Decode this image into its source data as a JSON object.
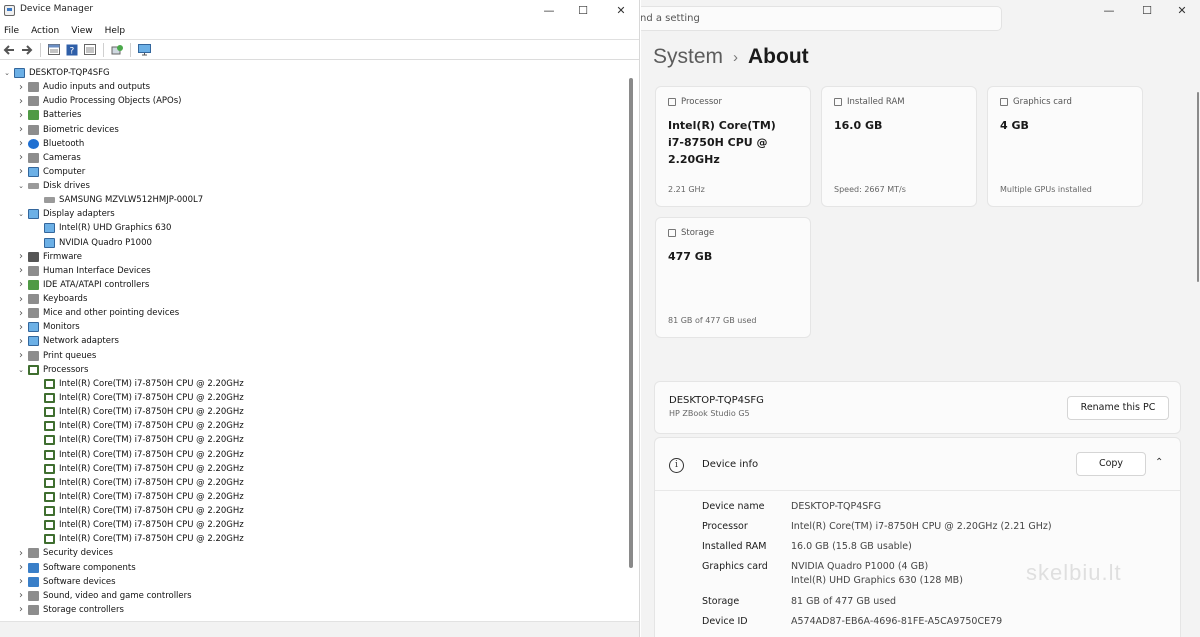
{
  "device_manager": {
    "title": "Device Manager",
    "menu": [
      "File",
      "Action",
      "View",
      "Help"
    ],
    "toolbar_icons": [
      "back-icon",
      "forward-icon",
      "properties-icon",
      "help-icon",
      "view-icon",
      "scan-icon",
      "monitor-icon"
    ],
    "tree": [
      {
        "label": "DESKTOP-TQP4SFG",
        "level": 0,
        "expanded": true,
        "icon": "computer"
      },
      {
        "label": "Audio inputs and outputs",
        "level": 1,
        "expanded": false,
        "icon": "gray"
      },
      {
        "label": "Audio Processing Objects (APOs)",
        "level": 1,
        "expanded": false,
        "icon": "gray"
      },
      {
        "label": "Batteries",
        "level": 1,
        "expanded": false,
        "icon": "green"
      },
      {
        "label": "Biometric devices",
        "level": 1,
        "expanded": false,
        "icon": "gray"
      },
      {
        "label": "Bluetooth",
        "level": 1,
        "expanded": false,
        "icon": "bt"
      },
      {
        "label": "Cameras",
        "level": 1,
        "expanded": false,
        "icon": "gray"
      },
      {
        "label": "Computer",
        "level": 1,
        "expanded": false,
        "icon": "mon"
      },
      {
        "label": "Disk drives",
        "level": 1,
        "expanded": true,
        "icon": "disk"
      },
      {
        "label": "SAMSUNG MZVLW512HMJP-000L7",
        "level": 2,
        "icon": "disk"
      },
      {
        "label": "Display adapters",
        "level": 1,
        "expanded": true,
        "icon": "mon"
      },
      {
        "label": "Intel(R) UHD Graphics 630",
        "level": 2,
        "icon": "mon"
      },
      {
        "label": "NVIDIA Quadro P1000",
        "level": 2,
        "icon": "mon"
      },
      {
        "label": "Firmware",
        "level": 1,
        "expanded": false,
        "icon": "dark"
      },
      {
        "label": "Human Interface Devices",
        "level": 1,
        "expanded": false,
        "icon": "gray"
      },
      {
        "label": "IDE ATA/ATAPI controllers",
        "level": 1,
        "expanded": false,
        "icon": "green"
      },
      {
        "label": "Keyboards",
        "level": 1,
        "expanded": false,
        "icon": "gray"
      },
      {
        "label": "Mice and other pointing devices",
        "level": 1,
        "expanded": false,
        "icon": "gray"
      },
      {
        "label": "Monitors",
        "level": 1,
        "expanded": false,
        "icon": "mon"
      },
      {
        "label": "Network adapters",
        "level": 1,
        "expanded": false,
        "icon": "mon"
      },
      {
        "label": "Print queues",
        "level": 1,
        "expanded": false,
        "icon": "gray"
      },
      {
        "label": "Processors",
        "level": 1,
        "expanded": true,
        "icon": "cpu"
      },
      {
        "label": "Intel(R) Core(TM) i7-8750H CPU @ 2.20GHz",
        "level": 2,
        "icon": "cpu"
      },
      {
        "label": "Intel(R) Core(TM) i7-8750H CPU @ 2.20GHz",
        "level": 2,
        "icon": "cpu"
      },
      {
        "label": "Intel(R) Core(TM) i7-8750H CPU @ 2.20GHz",
        "level": 2,
        "icon": "cpu"
      },
      {
        "label": "Intel(R) Core(TM) i7-8750H CPU @ 2.20GHz",
        "level": 2,
        "icon": "cpu"
      },
      {
        "label": "Intel(R) Core(TM) i7-8750H CPU @ 2.20GHz",
        "level": 2,
        "icon": "cpu"
      },
      {
        "label": "Intel(R) Core(TM) i7-8750H CPU @ 2.20GHz",
        "level": 2,
        "icon": "cpu"
      },
      {
        "label": "Intel(R) Core(TM) i7-8750H CPU @ 2.20GHz",
        "level": 2,
        "icon": "cpu"
      },
      {
        "label": "Intel(R) Core(TM) i7-8750H CPU @ 2.20GHz",
        "level": 2,
        "icon": "cpu"
      },
      {
        "label": "Intel(R) Core(TM) i7-8750H CPU @ 2.20GHz",
        "level": 2,
        "icon": "cpu"
      },
      {
        "label": "Intel(R) Core(TM) i7-8750H CPU @ 2.20GHz",
        "level": 2,
        "icon": "cpu"
      },
      {
        "label": "Intel(R) Core(TM) i7-8750H CPU @ 2.20GHz",
        "level": 2,
        "icon": "cpu"
      },
      {
        "label": "Intel(R) Core(TM) i7-8750H CPU @ 2.20GHz",
        "level": 2,
        "icon": "cpu"
      },
      {
        "label": "Security devices",
        "level": 1,
        "expanded": false,
        "icon": "gray"
      },
      {
        "label": "Software components",
        "level": 1,
        "expanded": false,
        "icon": "blue"
      },
      {
        "label": "Software devices",
        "level": 1,
        "expanded": false,
        "icon": "blue"
      },
      {
        "label": "Sound, video and game controllers",
        "level": 1,
        "expanded": false,
        "icon": "gray"
      },
      {
        "label": "Storage controllers",
        "level": 1,
        "expanded": false,
        "icon": "gray"
      }
    ]
  },
  "settings": {
    "search_text": "nd a setting",
    "breadcrumb": {
      "parent": "System",
      "separator": "›",
      "current": "About"
    },
    "cards": [
      {
        "label": "Processor",
        "value": "Intel(R) Core(TM) i7-8750H CPU @ 2.20GHz",
        "sub": "2.21 GHz"
      },
      {
        "label": "Installed RAM",
        "value": "16.0 GB",
        "sub": "Speed: 2667 MT/s"
      },
      {
        "label": "Graphics card",
        "value": "4 GB",
        "sub": "Multiple GPUs installed"
      },
      {
        "label": "Storage",
        "value": "477 GB",
        "sub": "81 GB of 477 GB used"
      }
    ],
    "pc": {
      "name": "DESKTOP-TQP4SFG",
      "model": "HP ZBook Studio G5",
      "rename_label": "Rename this PC"
    },
    "device_info": {
      "title": "Device info",
      "copy_label": "Copy",
      "rows": [
        {
          "label": "Device name",
          "value": "DESKTOP-TQP4SFG"
        },
        {
          "label": "Processor",
          "value": "Intel(R) Core(TM) i7-8750H CPU @ 2.20GHz (2.21 GHz)"
        },
        {
          "label": "Installed RAM",
          "value": "16.0 GB (15.8 GB usable)"
        },
        {
          "label": "Graphics card",
          "value": "NVIDIA Quadro P1000 (4 GB)",
          "value2": "Intel(R) UHD Graphics 630 (128 MB)"
        },
        {
          "label": "Storage",
          "value": "81 GB of 477 GB used"
        },
        {
          "label": "Device ID",
          "value": "A574AD87-EB6A-4696-81FE-A5CA9750CE79"
        }
      ]
    },
    "watermark": "skelbiu.lt"
  }
}
